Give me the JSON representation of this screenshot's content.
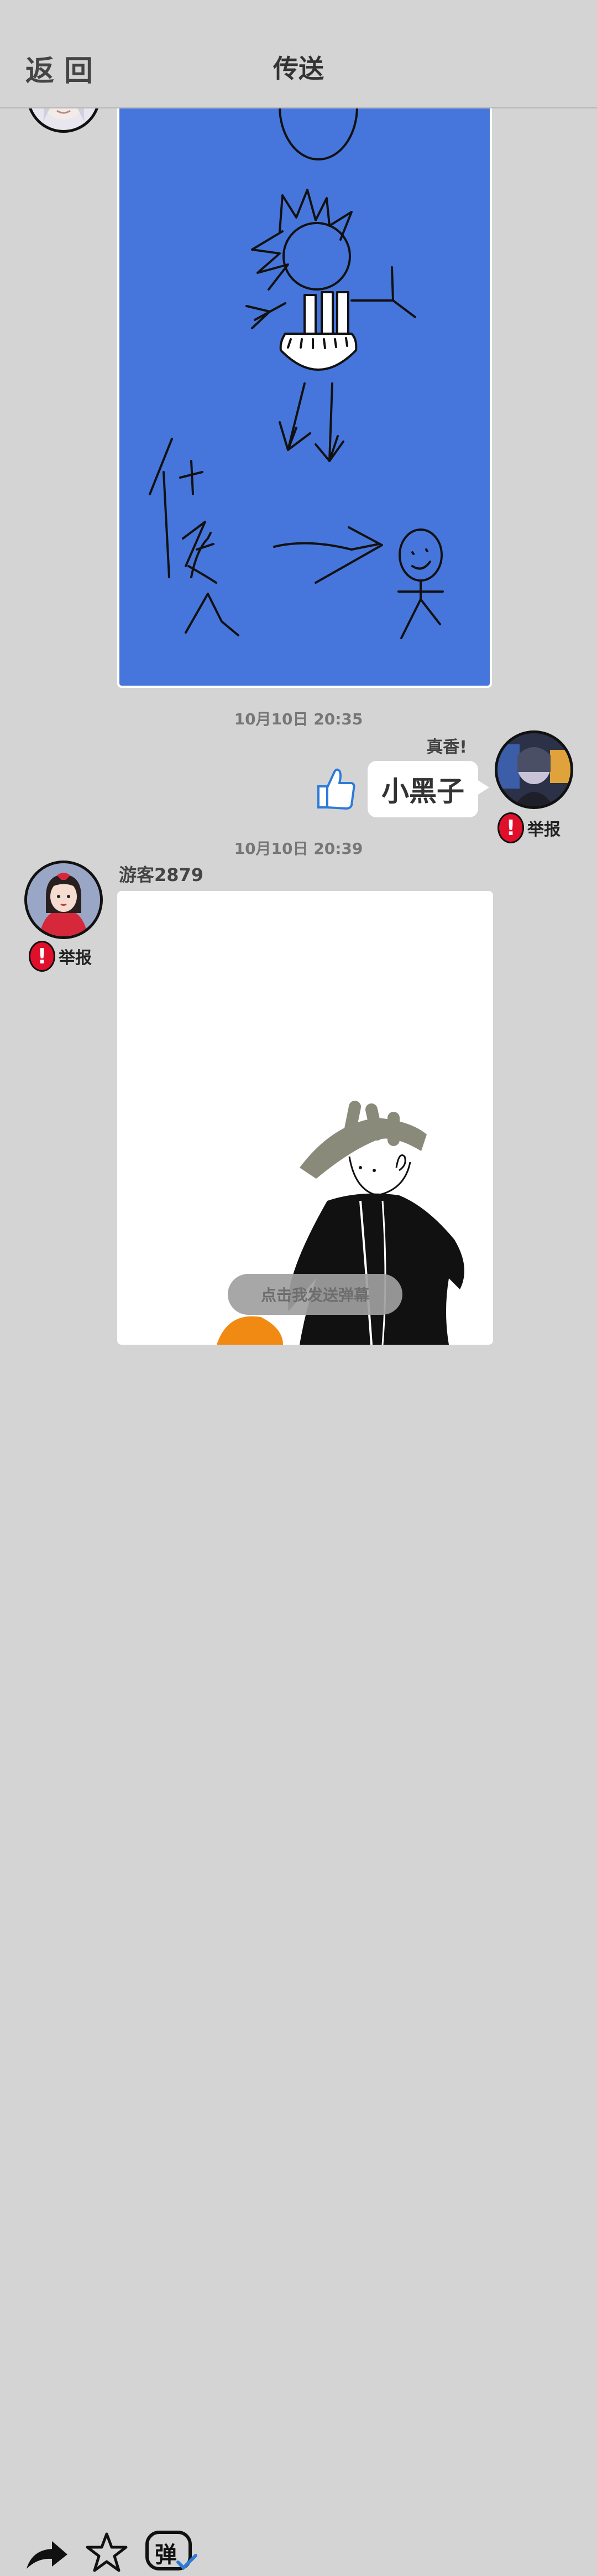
{
  "header": {
    "back_label": "返回",
    "title": "传送"
  },
  "messages": [
    {
      "id": "msg1",
      "type": "image",
      "content": "drawing-blue-background"
    },
    {
      "id": "msg2",
      "timestamp": "10月10日  20:35",
      "sender_caption": "真香!",
      "text": "小黑子",
      "report_label": "举报"
    },
    {
      "id": "msg3",
      "timestamp": "10月10日  20:39",
      "sender_name": "游客2879",
      "report_label": "举报",
      "type": "image"
    }
  ],
  "toolbar": {
    "danmaku_toggle_label": "弹",
    "danmaku_placeholder": "点击我发送弹幕"
  },
  "colors": {
    "background": "#d4d4d4",
    "drawing_blue": "#4676db",
    "report_red": "#e0102b",
    "thumb_blue": "#2d7bd8"
  }
}
